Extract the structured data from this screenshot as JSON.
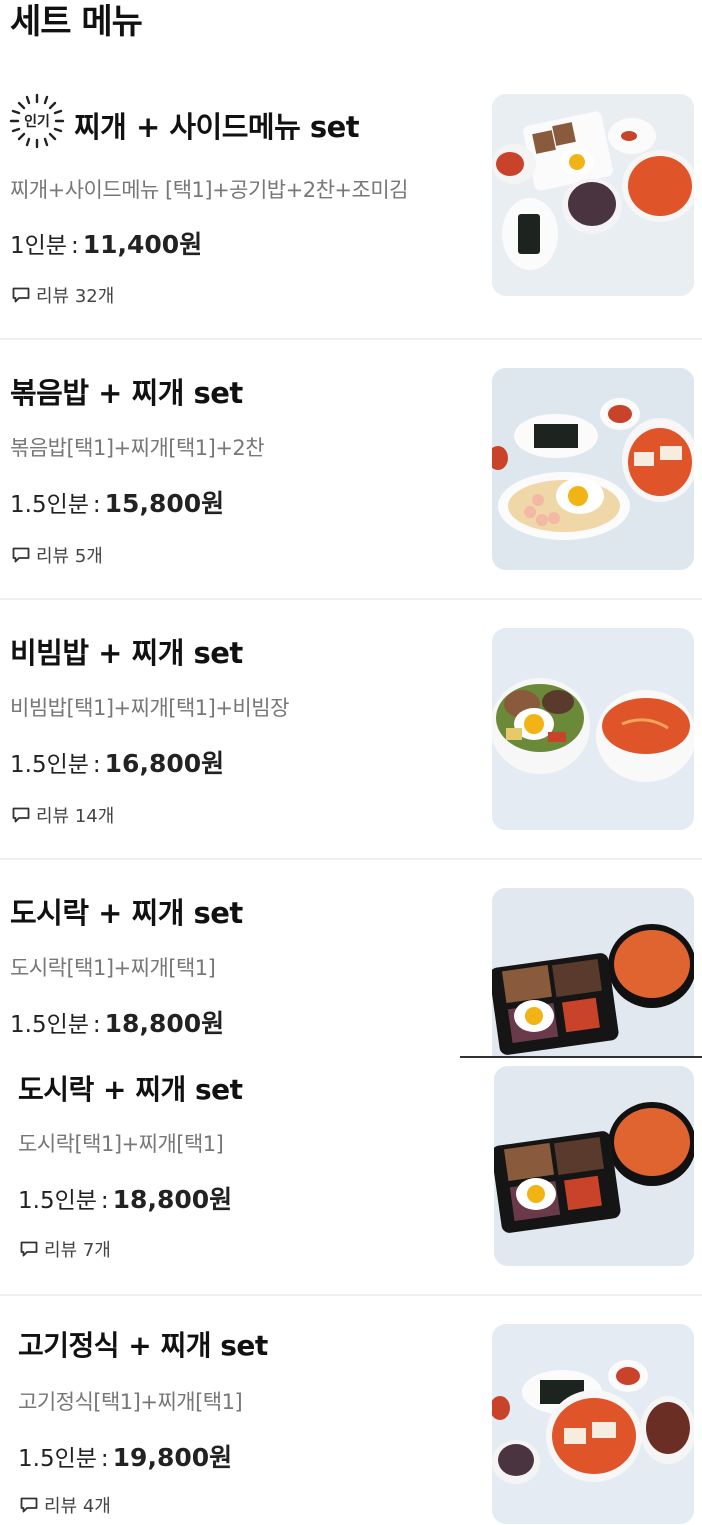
{
  "page_title": "세트 메뉴",
  "popular_badge": "인기",
  "items": [
    {
      "name": "찌개 + 사이드메뉴 set",
      "desc": "찌개+사이드메뉴 [택1]+공기밥+2찬+조미김",
      "portion": "1인분",
      "sep": ":",
      "price": "11,400원",
      "review": "리뷰 32개"
    },
    {
      "name": "볶음밥 + 찌개 set",
      "desc": "볶음밥[택1]+찌개[택1]+2찬",
      "portion": "1.5인분",
      "sep": ":",
      "price": "15,800원",
      "review": "리뷰 5개"
    },
    {
      "name": "비빔밥 + 찌개 set",
      "desc": "비빔밥[택1]+찌개[택1]+비빔장",
      "portion": "1.5인분",
      "sep": ":",
      "price": "16,800원",
      "review": "리뷰 14개"
    },
    {
      "name": "도시락 + 찌개 set",
      "desc": "도시락[택1]+찌개[택1]",
      "portion": "1.5인분",
      "sep": ":",
      "price": "18,800원",
      "review": ""
    },
    {
      "name": "도시락 + 찌개 set",
      "desc": "도시락[택1]+찌개[택1]",
      "portion": "1.5인분",
      "sep": ":",
      "price": "18,800원",
      "review": "리뷰 7개"
    },
    {
      "name": "고기정식 + 찌개 set",
      "desc": "고기정식[택1]+찌개[택1]",
      "portion": "1.5인분",
      "sep": ":",
      "price": "19,800원",
      "review": "리뷰 4개"
    }
  ],
  "colors": {
    "text": "#111111",
    "secondary": "#777777",
    "thumb_bg": "#e7edf3",
    "stew": "#e0542a",
    "divider": "#f0f0f0"
  }
}
